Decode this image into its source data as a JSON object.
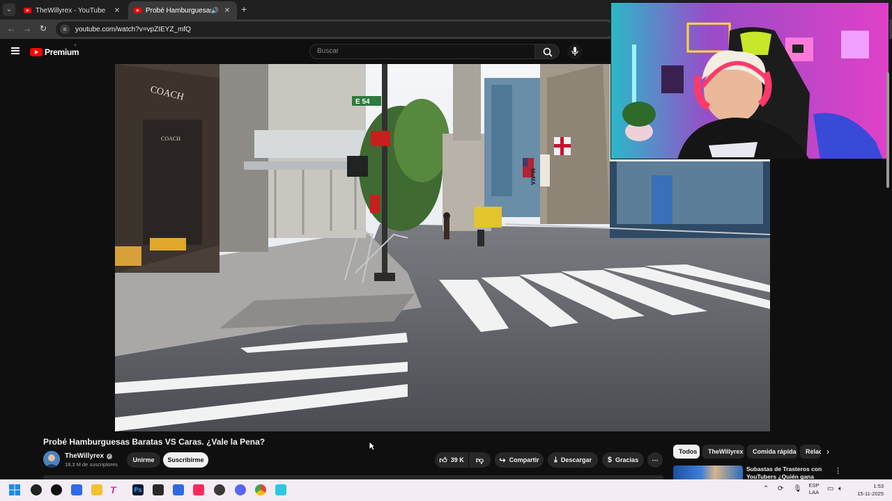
{
  "browser": {
    "tabs": [
      {
        "title": "TheWillyrex - YouTube",
        "active": false
      },
      {
        "title": "Probé Hamburguesas Barat",
        "active": true
      }
    ],
    "url": "youtube.com/watch?v=vpZIEYZ_mfQ"
  },
  "youtube": {
    "logo_text": "Premium",
    "search_placeholder": "Buscar"
  },
  "video": {
    "title": "Probé Hamburguesas Baratas VS Caras. ¿Vale la Pena?",
    "channel": "TheWillyrex",
    "subscribers": "18,3 M de suscriptores",
    "join_label": "Unirme",
    "subscribe_label": "Suscribirme",
    "likes": "39 K",
    "share_label": "Compartir",
    "download_label": "Descargar",
    "thanks_label": "Gracias",
    "scene_signs": {
      "street": "E 54",
      "store": "COACH",
      "store_small": "COACH",
      "museum": "MoMA"
    }
  },
  "sidebar": {
    "chips": [
      "Todos",
      "TheWillyrex",
      "Comida rápida",
      "Relac"
    ],
    "recommendation_title": "Subastas de Trasteros con YouTubers ¿Quién gana más?"
  },
  "taskbar": {
    "lang_top": "ESP",
    "lang_bottom": "LAA",
    "time": "1:53",
    "date": "15-11-2025"
  },
  "colors": {
    "youtube_red": "#ff0000",
    "page_bg": "#0f0f0f",
    "chip_selected": "#f1f1f1",
    "webcam_bg": "#e040c8"
  }
}
